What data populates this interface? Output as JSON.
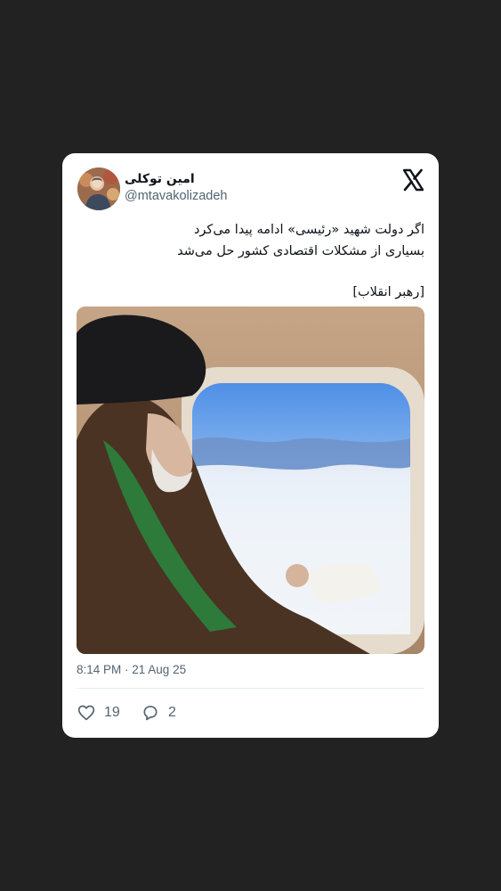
{
  "tweet": {
    "display_name": "امین توکلی",
    "handle": "@mtavakolizadeh",
    "text_lines": [
      "اگر دولت شهید «رئیسی» ادامه پیدا می‌کرد",
      "بسیاری از مشکلات اقتصادی کشور حل می‌شد",
      "[رهبر انقلاب]"
    ],
    "timestamp": "8:14 PM · 21 Aug 25",
    "likes": "19",
    "replies": "2"
  },
  "icons": {
    "logo": "x-logo-icon",
    "like": "heart-icon",
    "reply": "speech-bubble-icon"
  },
  "colors": {
    "background": "#222222",
    "card": "#ffffff",
    "text": "#0f1419",
    "muted": "#536471",
    "divider": "#e6ecf0"
  }
}
